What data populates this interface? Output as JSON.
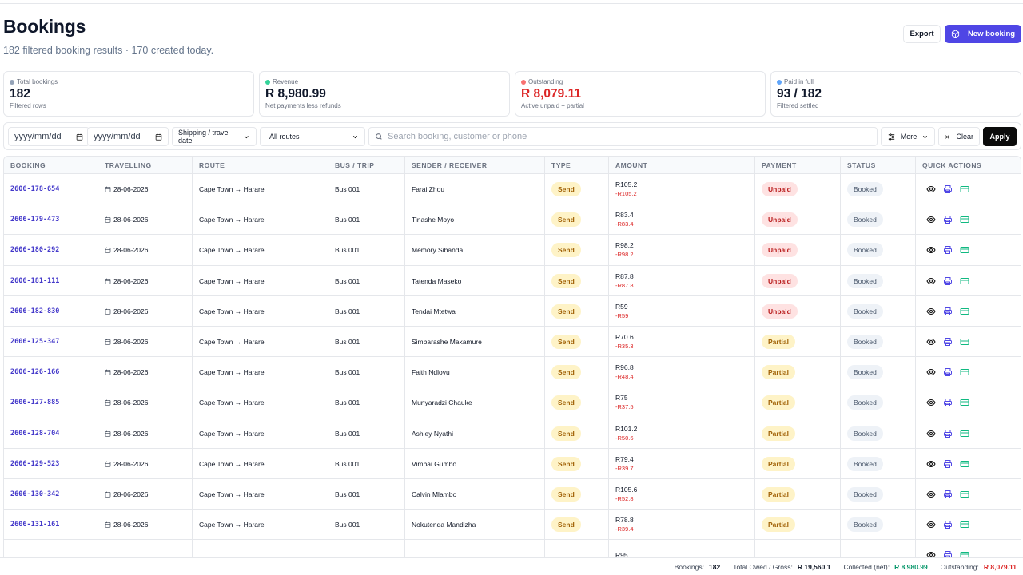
{
  "header": {
    "title": "Bookings",
    "subtitle": "182 filtered booking results · 170 created today.",
    "export_label": "Export",
    "new_booking_label": "New booking"
  },
  "stats": [
    {
      "label": "Total bookings",
      "value": "182",
      "sub": "Filtered rows",
      "color": "#94a3b8"
    },
    {
      "label": "Revenue",
      "value": "R 8,980.99",
      "sub": "Net payments less refunds",
      "color": "#34d399"
    },
    {
      "label": "Outstanding",
      "value": "R 8,079.11",
      "sub": "Active unpaid + partial",
      "color": "#f87171"
    },
    {
      "label": "Paid in full",
      "value": "93 / 182",
      "sub": "Filtered settled",
      "color": "#60a5fa"
    }
  ],
  "filters": {
    "date_from_placeholder": "yyyy/mm/dd",
    "date_to_placeholder": "yyyy/mm/dd",
    "date_type": "Shipping / travel date",
    "routes": "All routes",
    "search_placeholder": "Search booking, customer or phone",
    "more_label": "More",
    "clear_label": "Clear",
    "apply_label": "Apply"
  },
  "table": {
    "columns": [
      "BOOKING",
      "TRAVELLING",
      "ROUTE",
      "BUS / TRIP",
      "SENDER / RECEIVER",
      "TYPE",
      "AMOUNT",
      "PAYMENT",
      "STATUS",
      "QUICK ACTIONS"
    ],
    "rows": [
      {
        "booking": "2606-178-654",
        "date": "28-06-2026",
        "route": "Cape Town → Harare",
        "bus": "Bus 001",
        "sender": "Farai Zhou",
        "type": "Send",
        "amount": "R105.2",
        "due": "-R105.2",
        "payment": "Unpaid",
        "status": "Booked"
      },
      {
        "booking": "2606-179-473",
        "date": "28-06-2026",
        "route": "Cape Town → Harare",
        "bus": "Bus 001",
        "sender": "Tinashe Moyo",
        "type": "Send",
        "amount": "R83.4",
        "due": "-R83.4",
        "payment": "Unpaid",
        "status": "Booked"
      },
      {
        "booking": "2606-180-292",
        "date": "28-06-2026",
        "route": "Cape Town → Harare",
        "bus": "Bus 001",
        "sender": "Memory Sibanda",
        "type": "Send",
        "amount": "R98.2",
        "due": "-R98.2",
        "payment": "Unpaid",
        "status": "Booked"
      },
      {
        "booking": "2606-181-111",
        "date": "28-06-2026",
        "route": "Cape Town → Harare",
        "bus": "Bus 001",
        "sender": "Tatenda Maseko",
        "type": "Send",
        "amount": "R87.8",
        "due": "-R87.8",
        "payment": "Unpaid",
        "status": "Booked"
      },
      {
        "booking": "2606-182-830",
        "date": "28-06-2026",
        "route": "Cape Town → Harare",
        "bus": "Bus 001",
        "sender": "Tendai Mtetwa",
        "type": "Send",
        "amount": "R59",
        "due": "-R59",
        "payment": "Unpaid",
        "status": "Booked"
      },
      {
        "booking": "2606-125-347",
        "date": "28-06-2026",
        "route": "Cape Town → Harare",
        "bus": "Bus 001",
        "sender": "Simbarashe Makamure",
        "type": "Send",
        "amount": "R70.6",
        "due": "-R35.3",
        "payment": "Partial",
        "status": "Booked"
      },
      {
        "booking": "2606-126-166",
        "date": "28-06-2026",
        "route": "Cape Town → Harare",
        "bus": "Bus 001",
        "sender": "Faith Ndlovu",
        "type": "Send",
        "amount": "R96.8",
        "due": "-R48.4",
        "payment": "Partial",
        "status": "Booked"
      },
      {
        "booking": "2606-127-885",
        "date": "28-06-2026",
        "route": "Cape Town → Harare",
        "bus": "Bus 001",
        "sender": "Munyaradzi Chauke",
        "type": "Send",
        "amount": "R75",
        "due": "-R37.5",
        "payment": "Partial",
        "status": "Booked"
      },
      {
        "booking": "2606-128-704",
        "date": "28-06-2026",
        "route": "Cape Town → Harare",
        "bus": "Bus 001",
        "sender": "Ashley Nyathi",
        "type": "Send",
        "amount": "R101.2",
        "due": "-R50.6",
        "payment": "Partial",
        "status": "Booked"
      },
      {
        "booking": "2606-129-523",
        "date": "28-06-2026",
        "route": "Cape Town → Harare",
        "bus": "Bus 001",
        "sender": "Vimbai Gumbo",
        "type": "Send",
        "amount": "R79.4",
        "due": "-R39.7",
        "payment": "Partial",
        "status": "Booked"
      },
      {
        "booking": "2606-130-342",
        "date": "28-06-2026",
        "route": "Cape Town → Harare",
        "bus": "Bus 001",
        "sender": "Calvin Mlambo",
        "type": "Send",
        "amount": "R105.6",
        "due": "-R52.8",
        "payment": "Partial",
        "status": "Booked"
      },
      {
        "booking": "2606-131-161",
        "date": "28-06-2026",
        "route": "Cape Town → Harare",
        "bus": "Bus 001",
        "sender": "Nokutenda Mandizha",
        "type": "Send",
        "amount": "R78.8",
        "due": "-R39.4",
        "payment": "Partial",
        "status": "Booked"
      },
      {
        "booking": "",
        "date": "",
        "route": "",
        "bus": "",
        "sender": "",
        "type": "",
        "amount": "R95",
        "due": "",
        "payment": "",
        "status": ""
      }
    ]
  },
  "footer": {
    "bookings_label": "Bookings:",
    "bookings_value": "182",
    "owed_label": "Total Owed / Gross:",
    "owed_value": "R 19,560.1",
    "collected_label": "Collected (net):",
    "collected_value": "R 8,980.99",
    "outstanding_label": "Outstanding:",
    "outstanding_value": "R 8,079.11"
  },
  "colors": {
    "accent": "#4f46e5",
    "link": "#4338ca",
    "danger": "#dc2626",
    "success": "#059669"
  },
  "icons": [
    "box-icon",
    "calendar-icon",
    "chevron-down-icon",
    "search-icon",
    "sliders-icon",
    "close-icon",
    "eye-icon",
    "printer-icon",
    "card-icon"
  ]
}
